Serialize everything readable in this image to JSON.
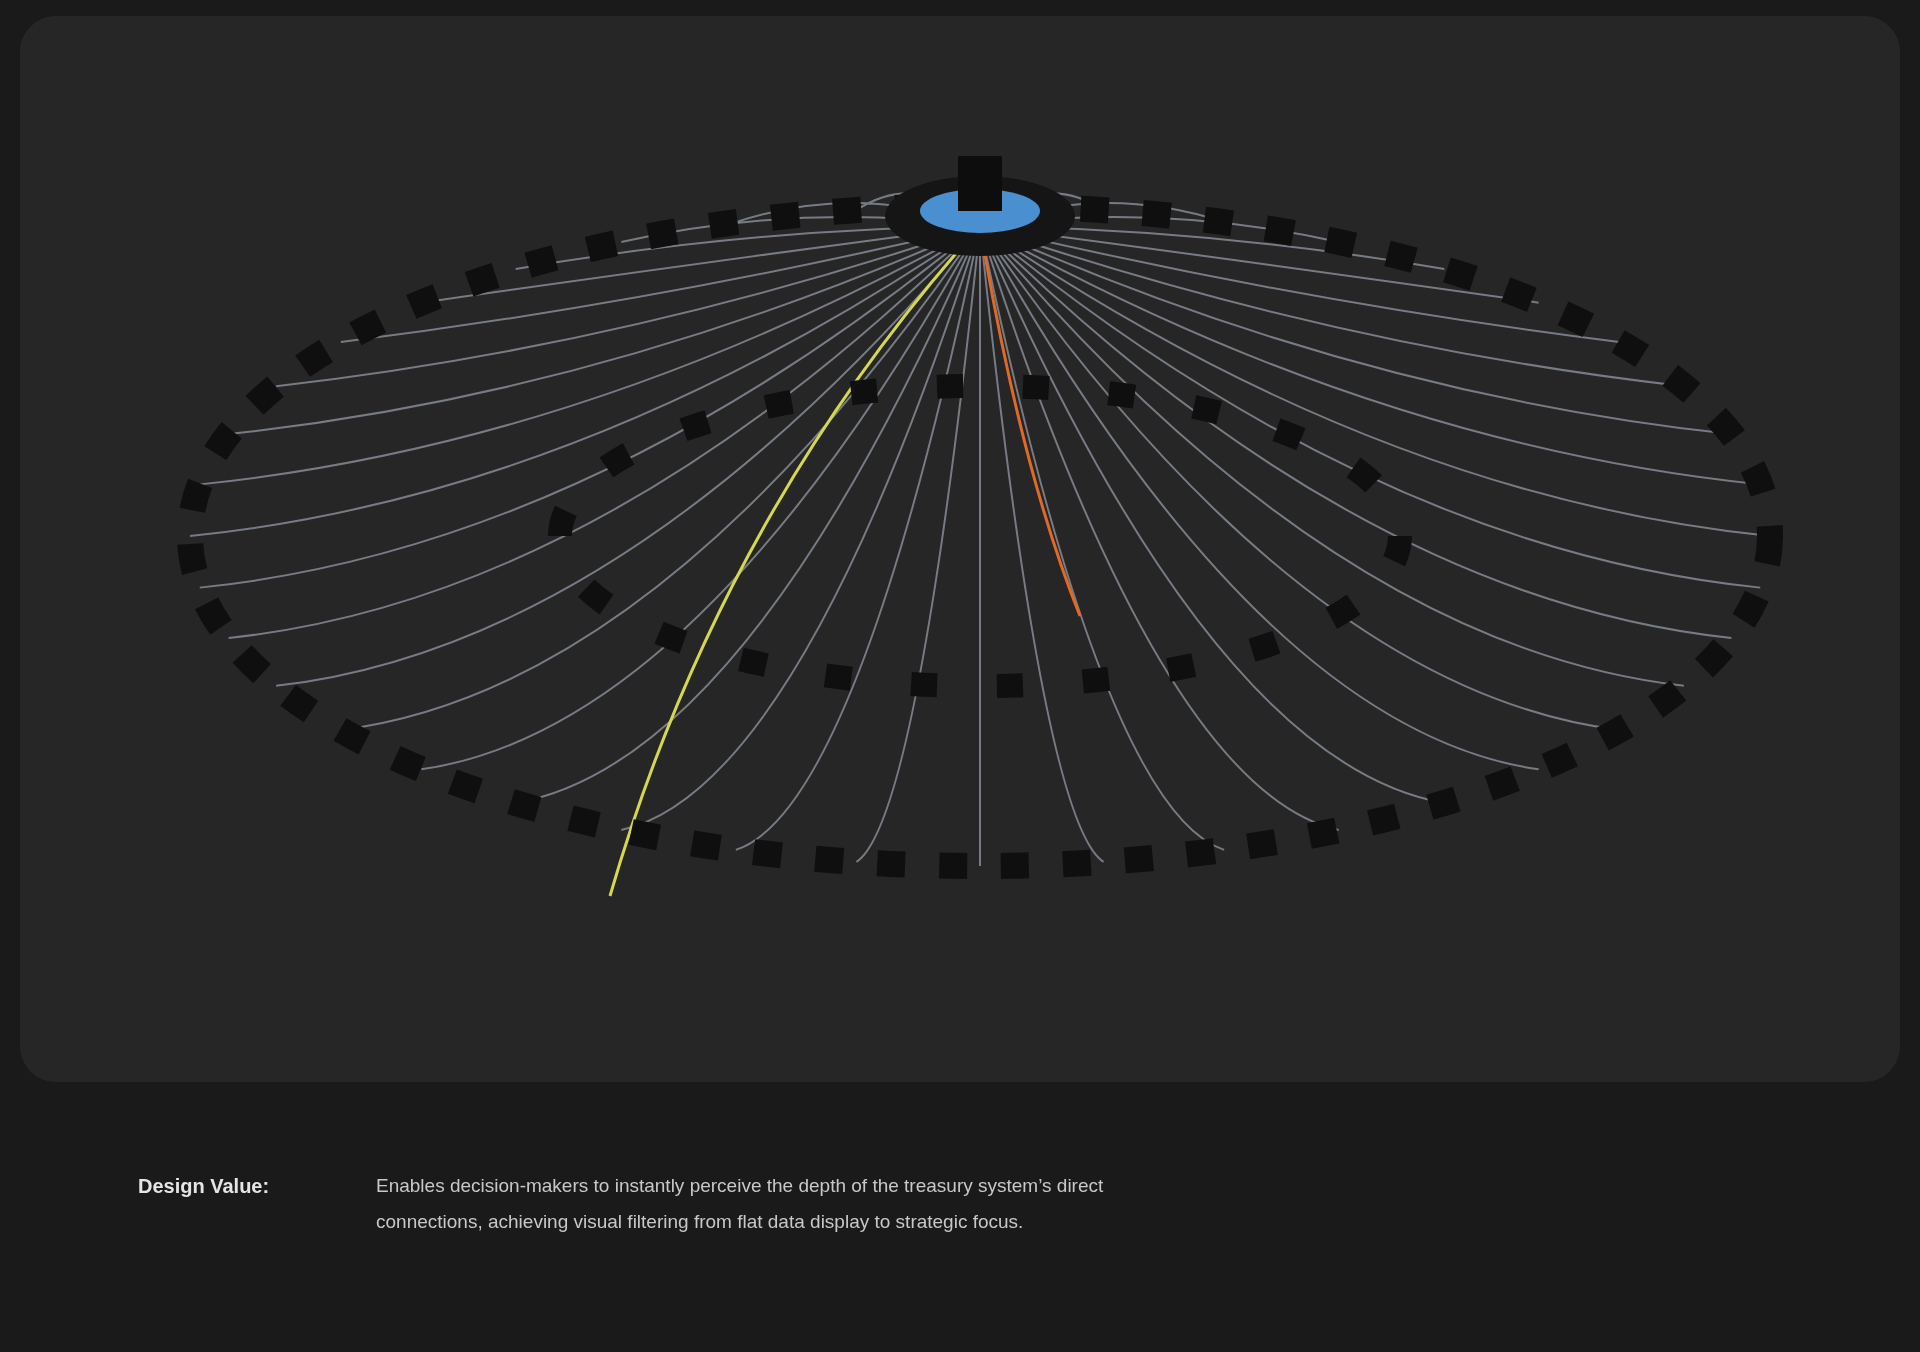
{
  "design_value": {
    "label": "Design Value:",
    "text": "Enables decision-makers to instantly perceive the depth of the treasury system’s direct connections, achieving visual filtering from flat data display to strategic focus."
  }
}
